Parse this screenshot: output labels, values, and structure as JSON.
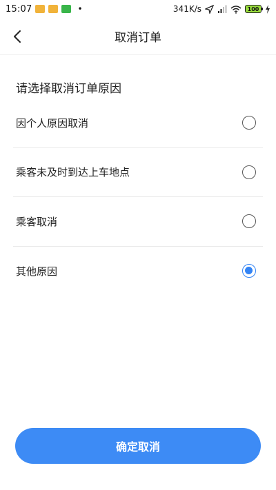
{
  "status_bar": {
    "time": "15:07",
    "dot": "•",
    "network_speed": "341K/s",
    "battery": "100"
  },
  "header": {
    "title": "取消订单"
  },
  "section": {
    "title": "请选择取消订单原因"
  },
  "reasons": [
    {
      "label": "因个人原因取消",
      "selected": false
    },
    {
      "label": "乘客未及时到达上车地点",
      "selected": false
    },
    {
      "label": "乘客取消",
      "selected": false
    },
    {
      "label": "其他原因",
      "selected": true
    }
  ],
  "footer": {
    "confirm_label": "确定取消"
  },
  "colors": {
    "accent": "#3d8bf5",
    "radio_checked": "#3384f5",
    "divider": "#e9e9e9"
  }
}
